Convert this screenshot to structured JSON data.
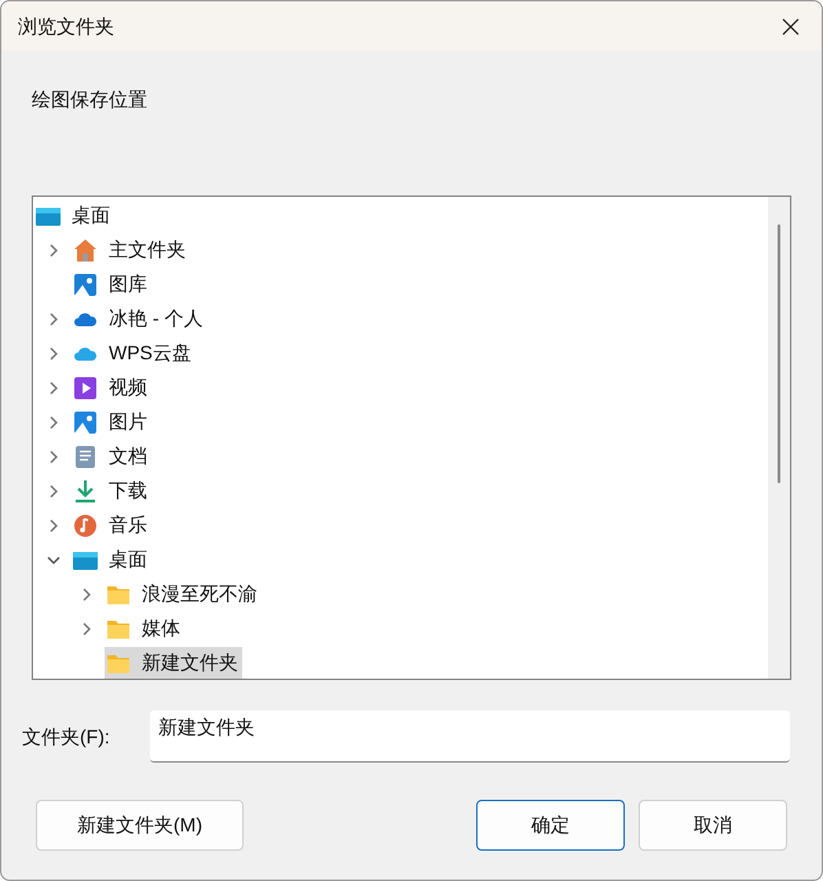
{
  "window": {
    "title": "浏览文件夹"
  },
  "prompt": "绘图保存位置",
  "tree": [
    {
      "label": "桌面",
      "kind": "desktop",
      "selected": false,
      "children": [
        {
          "label": "主文件夹",
          "kind": "home",
          "expanded": false,
          "selected": false
        },
        {
          "label": "图库",
          "kind": "gallery",
          "selected": false
        },
        {
          "label": "冰艳 - 个人",
          "kind": "cloud",
          "expanded": false,
          "selected": false
        },
        {
          "label": "WPS云盘",
          "kind": "cloud2",
          "expanded": false,
          "selected": false
        },
        {
          "label": "视频",
          "kind": "video",
          "expanded": false,
          "selected": false
        },
        {
          "label": "图片",
          "kind": "pictures",
          "expanded": false,
          "selected": false
        },
        {
          "label": "文档",
          "kind": "documents",
          "expanded": false,
          "selected": false
        },
        {
          "label": "下载",
          "kind": "downloads",
          "expanded": false,
          "selected": false
        },
        {
          "label": "音乐",
          "kind": "music",
          "expanded": false,
          "selected": false
        },
        {
          "label": "桌面",
          "kind": "desktop",
          "expanded": true,
          "selected": false,
          "children": [
            {
              "label": "浪漫至死不渝",
              "kind": "folder",
              "expanded": false,
              "selected": false
            },
            {
              "label": "媒体",
              "kind": "folder",
              "expanded": false,
              "selected": false
            },
            {
              "label": "新建文件夹",
              "kind": "folder",
              "selected": true
            }
          ]
        }
      ]
    }
  ],
  "folder_field": {
    "label": "文件夹(F):",
    "value": "新建文件夹"
  },
  "buttons": [
    {
      "label": "新建文件夹(M)",
      "kind": "secondary"
    },
    {
      "label": "确定",
      "kind": "default"
    },
    {
      "label": "取消",
      "kind": "secondary"
    }
  ]
}
